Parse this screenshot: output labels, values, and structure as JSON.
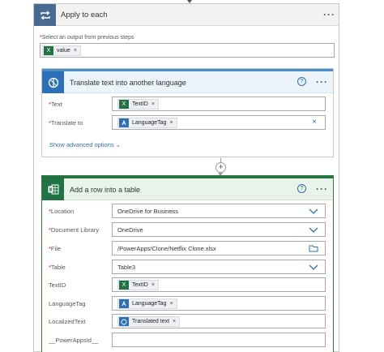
{
  "apply_each": {
    "title": "Apply to each",
    "select_label": "Select an output from previous steps",
    "required_mark": "*",
    "token": "value"
  },
  "translate": {
    "title": "Translate text into another language",
    "help": "?",
    "fields": [
      {
        "label": "Text",
        "required": "*",
        "token": "TextID",
        "token_icon": "excel-icon"
      },
      {
        "label": "Translate to",
        "required": "*",
        "token": "LanguageTag",
        "token_icon": "translator-icon",
        "clear": "×"
      }
    ],
    "advanced": "Show advanced options"
  },
  "add_row": {
    "title": "Add a row into a table",
    "help": "?",
    "location": {
      "label": "Location",
      "required": "*",
      "value": "OneDrive for Business"
    },
    "library": {
      "label": "Document Library",
      "required": "*",
      "value": "OneDrive"
    },
    "file": {
      "label": "File",
      "required": "*",
      "value": "/PowerApps/Clone/Netflix Clone.xlsx"
    },
    "table": {
      "label": "Table",
      "required": "*",
      "value": "Table3"
    },
    "textid": {
      "label": "TextID",
      "token": "TextID"
    },
    "languagetag": {
      "label": "LanguageTag",
      "token": "LanguageTag"
    },
    "localized": {
      "label": "LocalizedText",
      "token": "Translated text"
    },
    "powerappsid": {
      "label": "__PowerAppsId__"
    }
  },
  "token_remove": "×",
  "colors": {
    "loop_header": "#486991",
    "translator": "#2d70b5",
    "excel": "#217346"
  }
}
